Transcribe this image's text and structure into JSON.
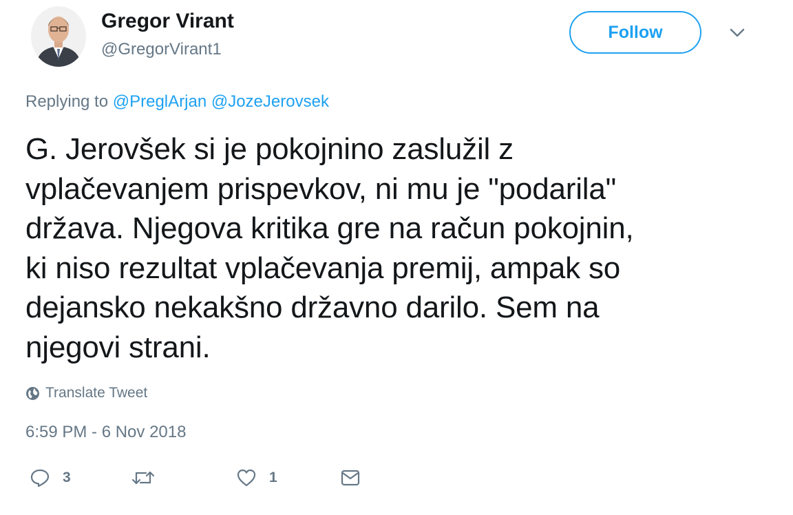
{
  "author": {
    "name": "Gregor Virant",
    "handle": "@GregorVirant1",
    "avatar_icon": "profile-photo"
  },
  "header": {
    "follow_label": "Follow",
    "caret_icon": "chevron-down-icon"
  },
  "reply": {
    "prefix": "Replying to ",
    "mentions": [
      "@PreglArjan",
      "@JozeJerovsek"
    ]
  },
  "tweet": {
    "lines": [
      "G. Jerovšek si je pokojnino zaslužil z",
      "vplačevanjem prispevkov, ni mu je \"podarila\"",
      "država. Njegova kritika gre na račun pokojnin,",
      "ki niso rezultat vplačevanja premij, ampak so",
      "dejansko nekakšno državno darilo. Sem na",
      "njegovi strani."
    ]
  },
  "translate": {
    "label": "Translate Tweet",
    "icon": "globe-icon"
  },
  "timestamp": "6:59 PM - 6 Nov 2018",
  "actions": {
    "reply_count": "3",
    "retweet_count": "",
    "like_count": "1"
  },
  "colors": {
    "accent": "#1da1f2",
    "secondary_text": "#657786",
    "primary_text": "#14171a"
  }
}
